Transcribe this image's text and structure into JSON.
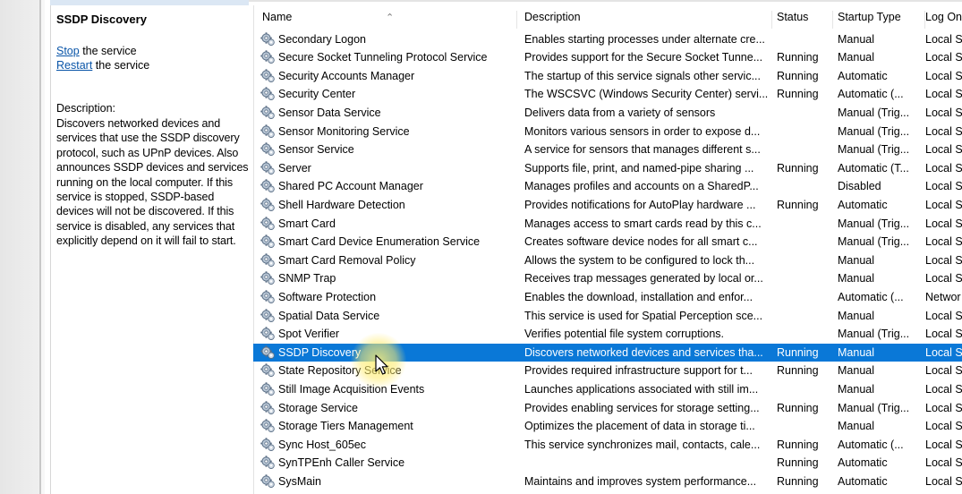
{
  "detail": {
    "title": "SSDP Discovery",
    "stop_link": "Stop",
    "stop_suffix": " the service",
    "restart_link": "Restart",
    "restart_suffix": " the service",
    "description_label": "Description:",
    "description_lines": [
      "Discovers networked devices and",
      "services that use the SSDP discovery",
      "protocol, such as UPnP devices. Also",
      "announces SSDP devices and services",
      "running on the local computer. If this",
      "service is stopped, SSDP-based",
      "devices will not be discovered. If this",
      "service is disabled, any services that",
      "explicitly depend on it will fail to start."
    ]
  },
  "columns": {
    "name": "Name",
    "description": "Description",
    "status": "Status",
    "startup_type": "Startup Type",
    "log_on_as": "Log On"
  },
  "services": [
    {
      "name": "Secondary Logon",
      "description": "Enables starting processes under alternate cre...",
      "status": "",
      "startup": "Manual",
      "logon": "Local S"
    },
    {
      "name": "Secure Socket Tunneling Protocol Service",
      "description": "Provides support for the Secure Socket Tunne...",
      "status": "Running",
      "startup": "Manual",
      "logon": "Local S"
    },
    {
      "name": "Security Accounts Manager",
      "description": "The startup of this service signals other servic...",
      "status": "Running",
      "startup": "Automatic",
      "logon": "Local S"
    },
    {
      "name": "Security Center",
      "description": "The WSCSVC (Windows Security Center) servi...",
      "status": "Running",
      "startup": "Automatic (...",
      "logon": "Local S"
    },
    {
      "name": "Sensor Data Service",
      "description": "Delivers data from a variety of sensors",
      "status": "",
      "startup": "Manual (Trig...",
      "logon": "Local S"
    },
    {
      "name": "Sensor Monitoring Service",
      "description": "Monitors various sensors in order to expose d...",
      "status": "",
      "startup": "Manual (Trig...",
      "logon": "Local S"
    },
    {
      "name": "Sensor Service",
      "description": "A service for sensors that manages different s...",
      "status": "",
      "startup": "Manual (Trig...",
      "logon": "Local S"
    },
    {
      "name": "Server",
      "description": "Supports file, print, and named-pipe sharing ...",
      "status": "Running",
      "startup": "Automatic (T...",
      "logon": "Local S"
    },
    {
      "name": "Shared PC Account Manager",
      "description": "Manages profiles and accounts on a SharedP...",
      "status": "",
      "startup": "Disabled",
      "logon": "Local S"
    },
    {
      "name": "Shell Hardware Detection",
      "description": "Provides notifications for AutoPlay hardware ...",
      "status": "Running",
      "startup": "Automatic",
      "logon": "Local S"
    },
    {
      "name": "Smart Card",
      "description": "Manages access to smart cards read by this c...",
      "status": "",
      "startup": "Manual (Trig...",
      "logon": "Local S"
    },
    {
      "name": "Smart Card Device Enumeration Service",
      "description": "Creates software device nodes for all smart c...",
      "status": "",
      "startup": "Manual (Trig...",
      "logon": "Local S"
    },
    {
      "name": "Smart Card Removal Policy",
      "description": "Allows the system to be configured to lock th...",
      "status": "",
      "startup": "Manual",
      "logon": "Local S"
    },
    {
      "name": "SNMP Trap",
      "description": "Receives trap messages generated by local or...",
      "status": "",
      "startup": "Manual",
      "logon": "Local S"
    },
    {
      "name": "Software Protection",
      "description": "Enables the download, installation and enfor...",
      "status": "",
      "startup": "Automatic (...",
      "logon": "Networ"
    },
    {
      "name": "Spatial Data Service",
      "description": "This service is used for Spatial Perception sce...",
      "status": "",
      "startup": "Manual",
      "logon": "Local S"
    },
    {
      "name": "Spot Verifier",
      "description": "Verifies potential file system corruptions.",
      "status": "",
      "startup": "Manual (Trig...",
      "logon": "Local S"
    },
    {
      "name": "SSDP Discovery",
      "description": "Discovers networked devices and services tha...",
      "status": "Running",
      "startup": "Manual",
      "logon": "Local S",
      "selected": true
    },
    {
      "name": "State Repository Service",
      "description": "Provides required infrastructure support for t...",
      "status": "Running",
      "startup": "Manual",
      "logon": "Local S"
    },
    {
      "name": "Still Image Acquisition Events",
      "description": "Launches applications associated with still im...",
      "status": "",
      "startup": "Manual",
      "logon": "Local S"
    },
    {
      "name": "Storage Service",
      "description": "Provides enabling services for storage setting...",
      "status": "Running",
      "startup": "Manual (Trig...",
      "logon": "Local S"
    },
    {
      "name": "Storage Tiers Management",
      "description": "Optimizes the placement of data in storage ti...",
      "status": "",
      "startup": "Manual",
      "logon": "Local S"
    },
    {
      "name": "Sync Host_605ec",
      "description": "This service synchronizes mail, contacts, cale...",
      "status": "Running",
      "startup": "Automatic (...",
      "logon": "Local S"
    },
    {
      "name": "SynTPEnh Caller Service",
      "description": "",
      "status": "Running",
      "startup": "Automatic",
      "logon": "Local S"
    },
    {
      "name": "SysMain",
      "description": "Maintains and improves system performance...",
      "status": "Running",
      "startup": "Automatic",
      "logon": "Local S"
    }
  ],
  "colors": {
    "selection": "#0a78d7",
    "link": "#0a55a8"
  },
  "icons": {
    "service_icon": "gear-service-icon",
    "sort_indicator": "sort-ascending-icon",
    "cursor": "mouse-pointer-icon"
  }
}
